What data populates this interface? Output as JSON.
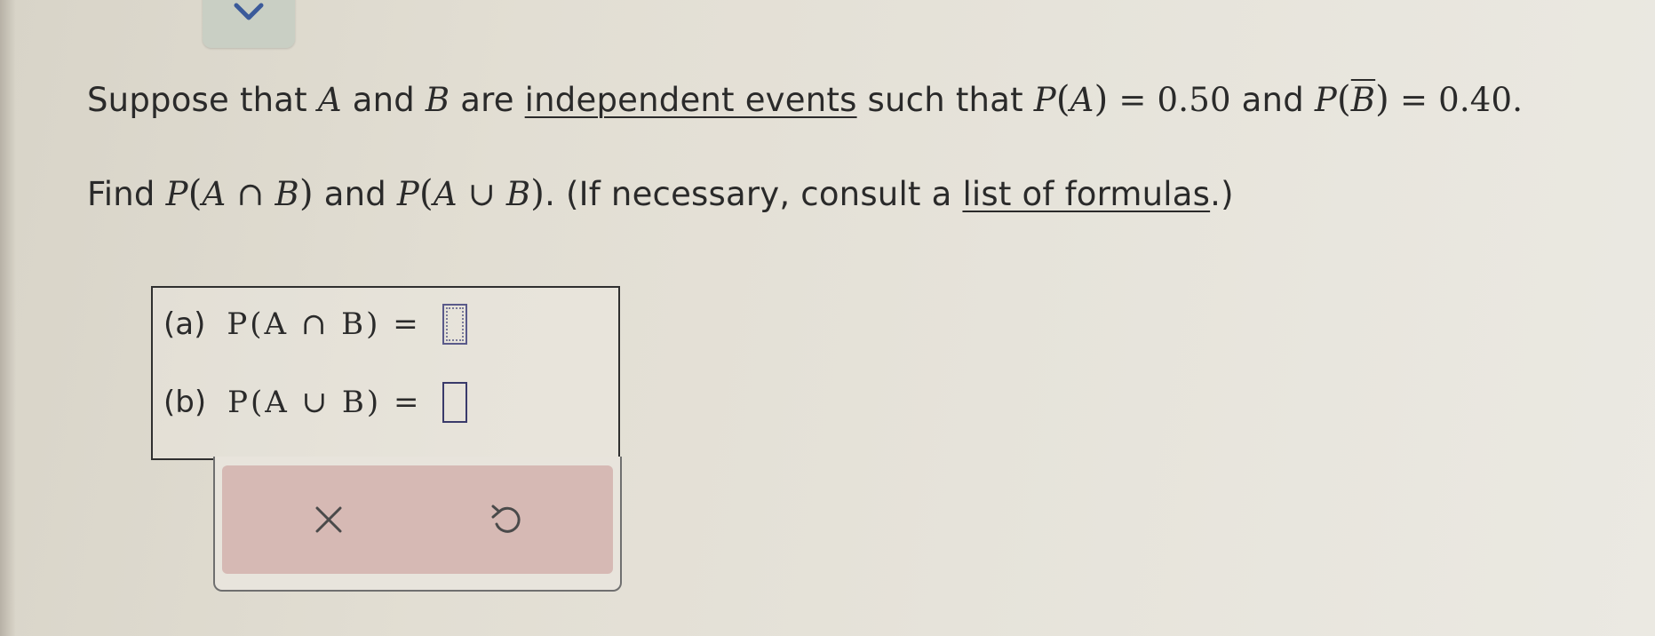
{
  "question": {
    "line1": {
      "t1": "Suppose that ",
      "var_a": "A",
      "t2": " and ",
      "var_b": "B",
      "t3": " are ",
      "link": "independent events",
      "t4": " such that ",
      "pa_p": "P",
      "pa_open": "(",
      "pa_var": "A",
      "pa_close": ")",
      "pa_eq": " = 0.50",
      "t5": " and ",
      "pb_p": "P",
      "pb_open": "(",
      "pb_var": "B",
      "pb_close": ")",
      "pb_eq": " = 0.40."
    },
    "line2": {
      "t1": "Find ",
      "f1_p": "P",
      "f1_open": "(",
      "f1_inner": "A ∩ B",
      "f1_close": ")",
      "t2": " and ",
      "f2_p": "P",
      "f2_open": "(",
      "f2_inner": "A ∪ B",
      "f2_close": ")",
      "t3": ". (If necessary, consult a ",
      "link": "list of formulas",
      "t4": ".)"
    }
  },
  "answers": [
    {
      "label": "(a)",
      "expr": "P(A ∩ B) =",
      "value": ""
    },
    {
      "label": "(b)",
      "expr": "P(A ∪ B) =",
      "value": ""
    }
  ],
  "buttons": {
    "clear_icon": "x-icon",
    "undo_icon": "undo-icon"
  },
  "colors": {
    "button_bg": "#d6b9b4",
    "tab_bg": "#c9cfc4",
    "chevron": "#3a5a9a"
  }
}
